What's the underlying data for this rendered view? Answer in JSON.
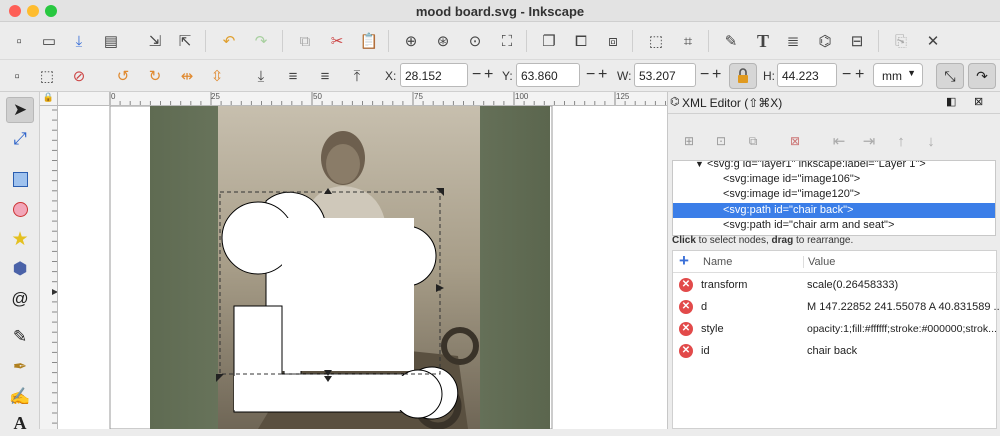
{
  "window": {
    "title": "mood board.svg - Inkscape",
    "traffic_colors": [
      "#fe5f57",
      "#febc2e",
      "#28c840"
    ]
  },
  "toolbar_icons": [
    "new-document-icon",
    "open-icon",
    "save-icon",
    "print-icon",
    "import-icon",
    "export-icon",
    "undo-icon",
    "redo-icon",
    "copy-icon",
    "cut-icon",
    "paste-icon",
    "zoom-selection-icon",
    "zoom-drawing-icon",
    "zoom-page-icon",
    "zoom-fit-icon",
    "duplicate-icon",
    "clone-icon",
    "unlink-clone-icon",
    "group-icon",
    "ungroup-icon",
    "fill-stroke-icon",
    "text-icon",
    "layers-icon",
    "xml-editor-icon",
    "align-icon",
    "preferences-icon",
    "document-properties-icon"
  ],
  "selector_toolbar": {
    "x_label": "X:",
    "x_value": "28.152",
    "y_label": "Y:",
    "y_value": "63.860",
    "w_label": "W:",
    "w_value": "53.207",
    "h_label": "H:",
    "h_value": "44.223",
    "unit": "mm"
  },
  "ruler": {
    "top_labels": [
      "0",
      "25",
      "50",
      "75",
      "100",
      "125"
    ]
  },
  "xml_editor": {
    "title": "XML Editor (⇧⌘X)",
    "nodes": [
      "<svg:g id=\"layer1\" inkscape:label=\"Layer 1\">",
      "<svg:image id=\"image106\">",
      "<svg:image id=\"image120\">",
      "<svg:path id=\"chair back\">",
      "<svg:path id=\"chair arm and seat\">"
    ],
    "hint_bold1": "Click",
    "hint_mid": " to select nodes, ",
    "hint_bold2": "drag",
    "hint_end": " to rearrange.",
    "col_name": "Name",
    "col_value": "Value",
    "attributes": [
      {
        "name": "transform",
        "value": "scale(0.26458333)"
      },
      {
        "name": "d",
        "value": "M 147.22852 241.55078 A 40.831589 ..."
      },
      {
        "name": "style",
        "value": "opacity:1;fill:#ffffff;stroke:#000000;strok..."
      },
      {
        "name": "id",
        "value": "chair back"
      }
    ],
    "selected_color": "#3b7ee8"
  }
}
